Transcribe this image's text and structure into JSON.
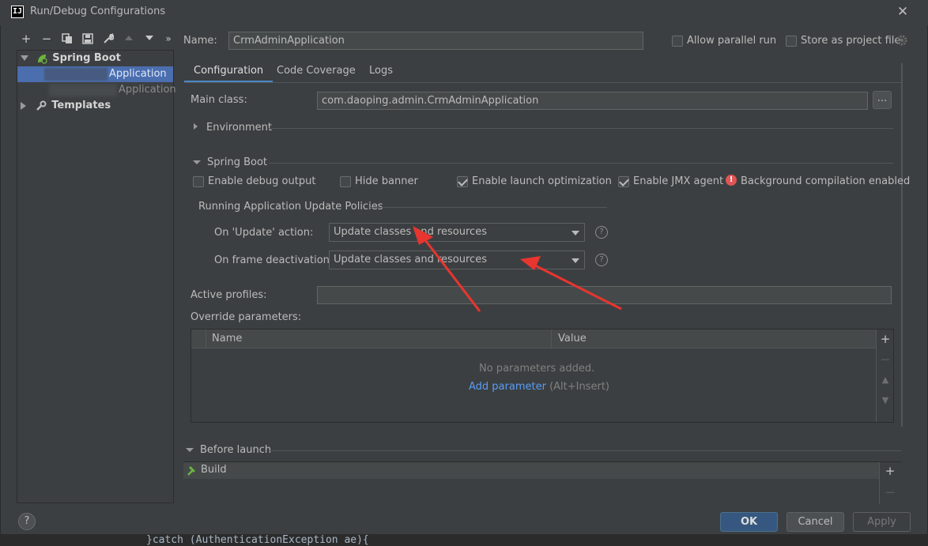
{
  "window": {
    "title": "Run/Debug Configurations",
    "app_icon": "IJ"
  },
  "toolbar": {
    "icons": [
      "add-icon",
      "remove-icon",
      "copy-icon",
      "save-icon",
      "wrench-icon",
      "move-up-icon",
      "move-down-icon",
      "more-icon"
    ]
  },
  "tree": {
    "spring_boot": "Spring Boot",
    "selected_item": "Application",
    "second_item": "Application",
    "templates": "Templates"
  },
  "name_row": {
    "label": "Name:",
    "value": "CrmAdminApplication",
    "allow_parallel": "Allow parallel run",
    "store_project": "Store as project file"
  },
  "tabs": [
    {
      "label": "Configuration"
    },
    {
      "label": "Code Coverage"
    },
    {
      "label": "Logs"
    }
  ],
  "config": {
    "main_class_label": "Main class:",
    "main_class_value": "com.daoping.admin.CrmAdminApplication",
    "browse": "...",
    "environment": "Environment",
    "spring_boot_section": "Spring Boot",
    "enable_debug": "Enable debug output",
    "hide_banner": "Hide banner",
    "enable_launch_opt": "Enable launch optimization",
    "enable_jmx": "Enable JMX agent",
    "bg_compilation": "Background compilation enabled",
    "policies_title": "Running Application Update Policies",
    "on_update_label": "On 'Update' action:",
    "on_update_value": "Update classes and resources",
    "on_frame_label": "On frame deactivation:",
    "on_frame_value": "Update classes and resources",
    "active_profiles_label": "Active profiles:",
    "active_profiles_value": "",
    "override_label": "Override parameters:"
  },
  "params_table": {
    "columns": [
      "Name",
      "Value"
    ],
    "empty_text": "No parameters added.",
    "add_link": "Add parameter",
    "add_hint": "(Alt+Insert)"
  },
  "before_launch": {
    "title": "Before launch",
    "items": [
      "Build"
    ]
  },
  "buttons": {
    "ok": "OK",
    "cancel": "Cancel",
    "apply": "Apply",
    "help": "?"
  },
  "background_code": "}catch (AuthenticationException ae){",
  "colors": {
    "accent": "#4b6eaf",
    "link": "#589df6",
    "annotation_arrow": "#e8352f"
  }
}
